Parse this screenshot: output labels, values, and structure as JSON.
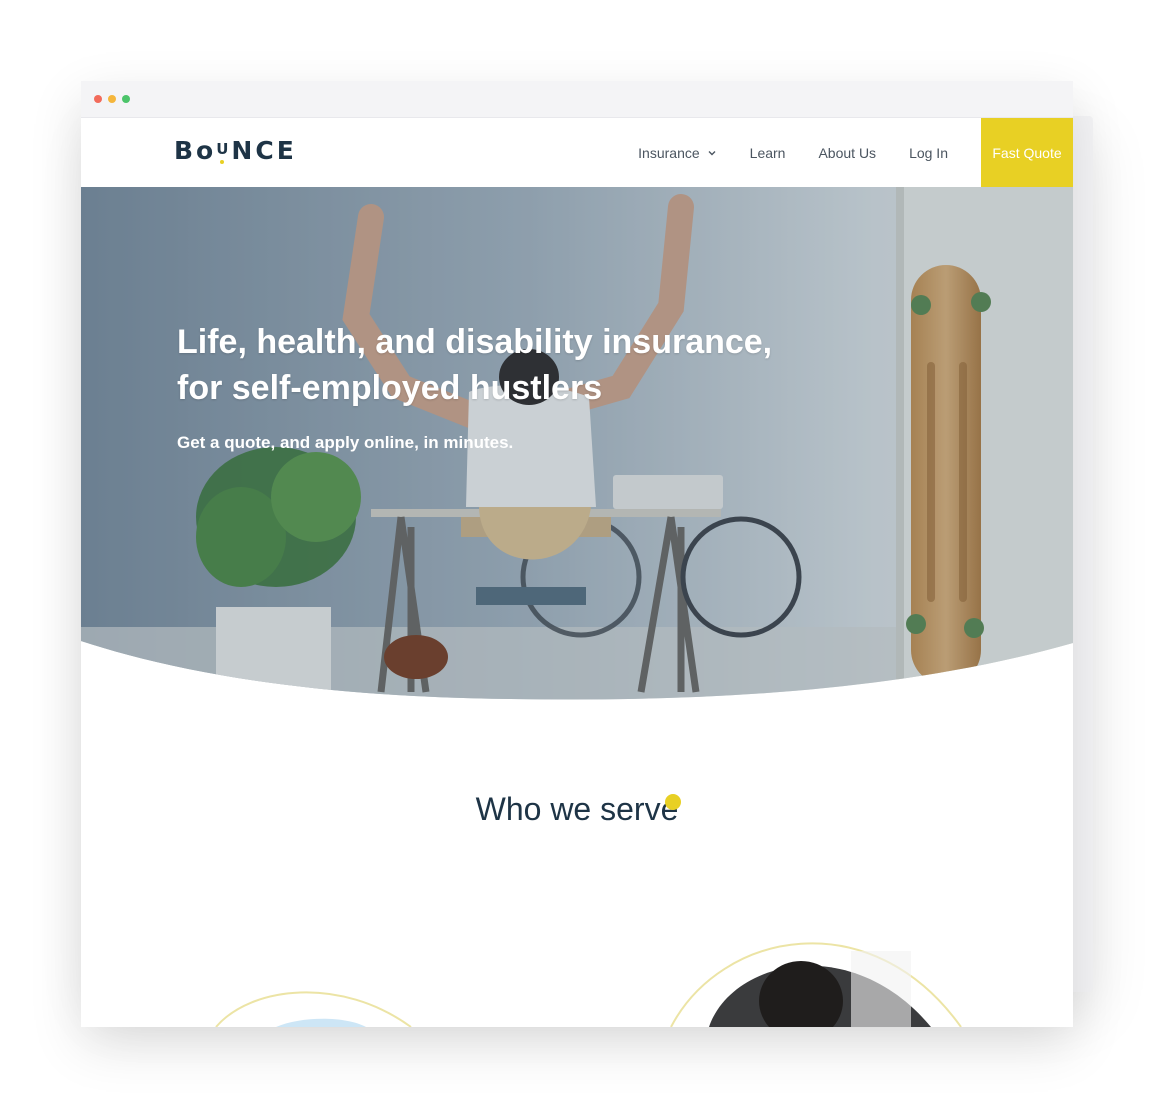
{
  "brand": {
    "logo_text": "BoUNCE",
    "logo_parts": {
      "pre": "Bo",
      "u": "U",
      "post": "NCE"
    },
    "accent_color": "#e8d024",
    "text_color": "#1e3446"
  },
  "nav": {
    "items": [
      {
        "label": "Insurance",
        "has_dropdown": true
      },
      {
        "label": "Learn"
      },
      {
        "label": "About Us"
      },
      {
        "label": "Log In"
      }
    ],
    "cta_label": "Fast Quote"
  },
  "hero": {
    "title": "Life, health, and disability insurance, for self-employed hustlers",
    "subtitle": "Get a quote, and apply online, in minutes."
  },
  "section": {
    "title": "Who we serve"
  },
  "icons": [
    "chevron-down-icon"
  ]
}
